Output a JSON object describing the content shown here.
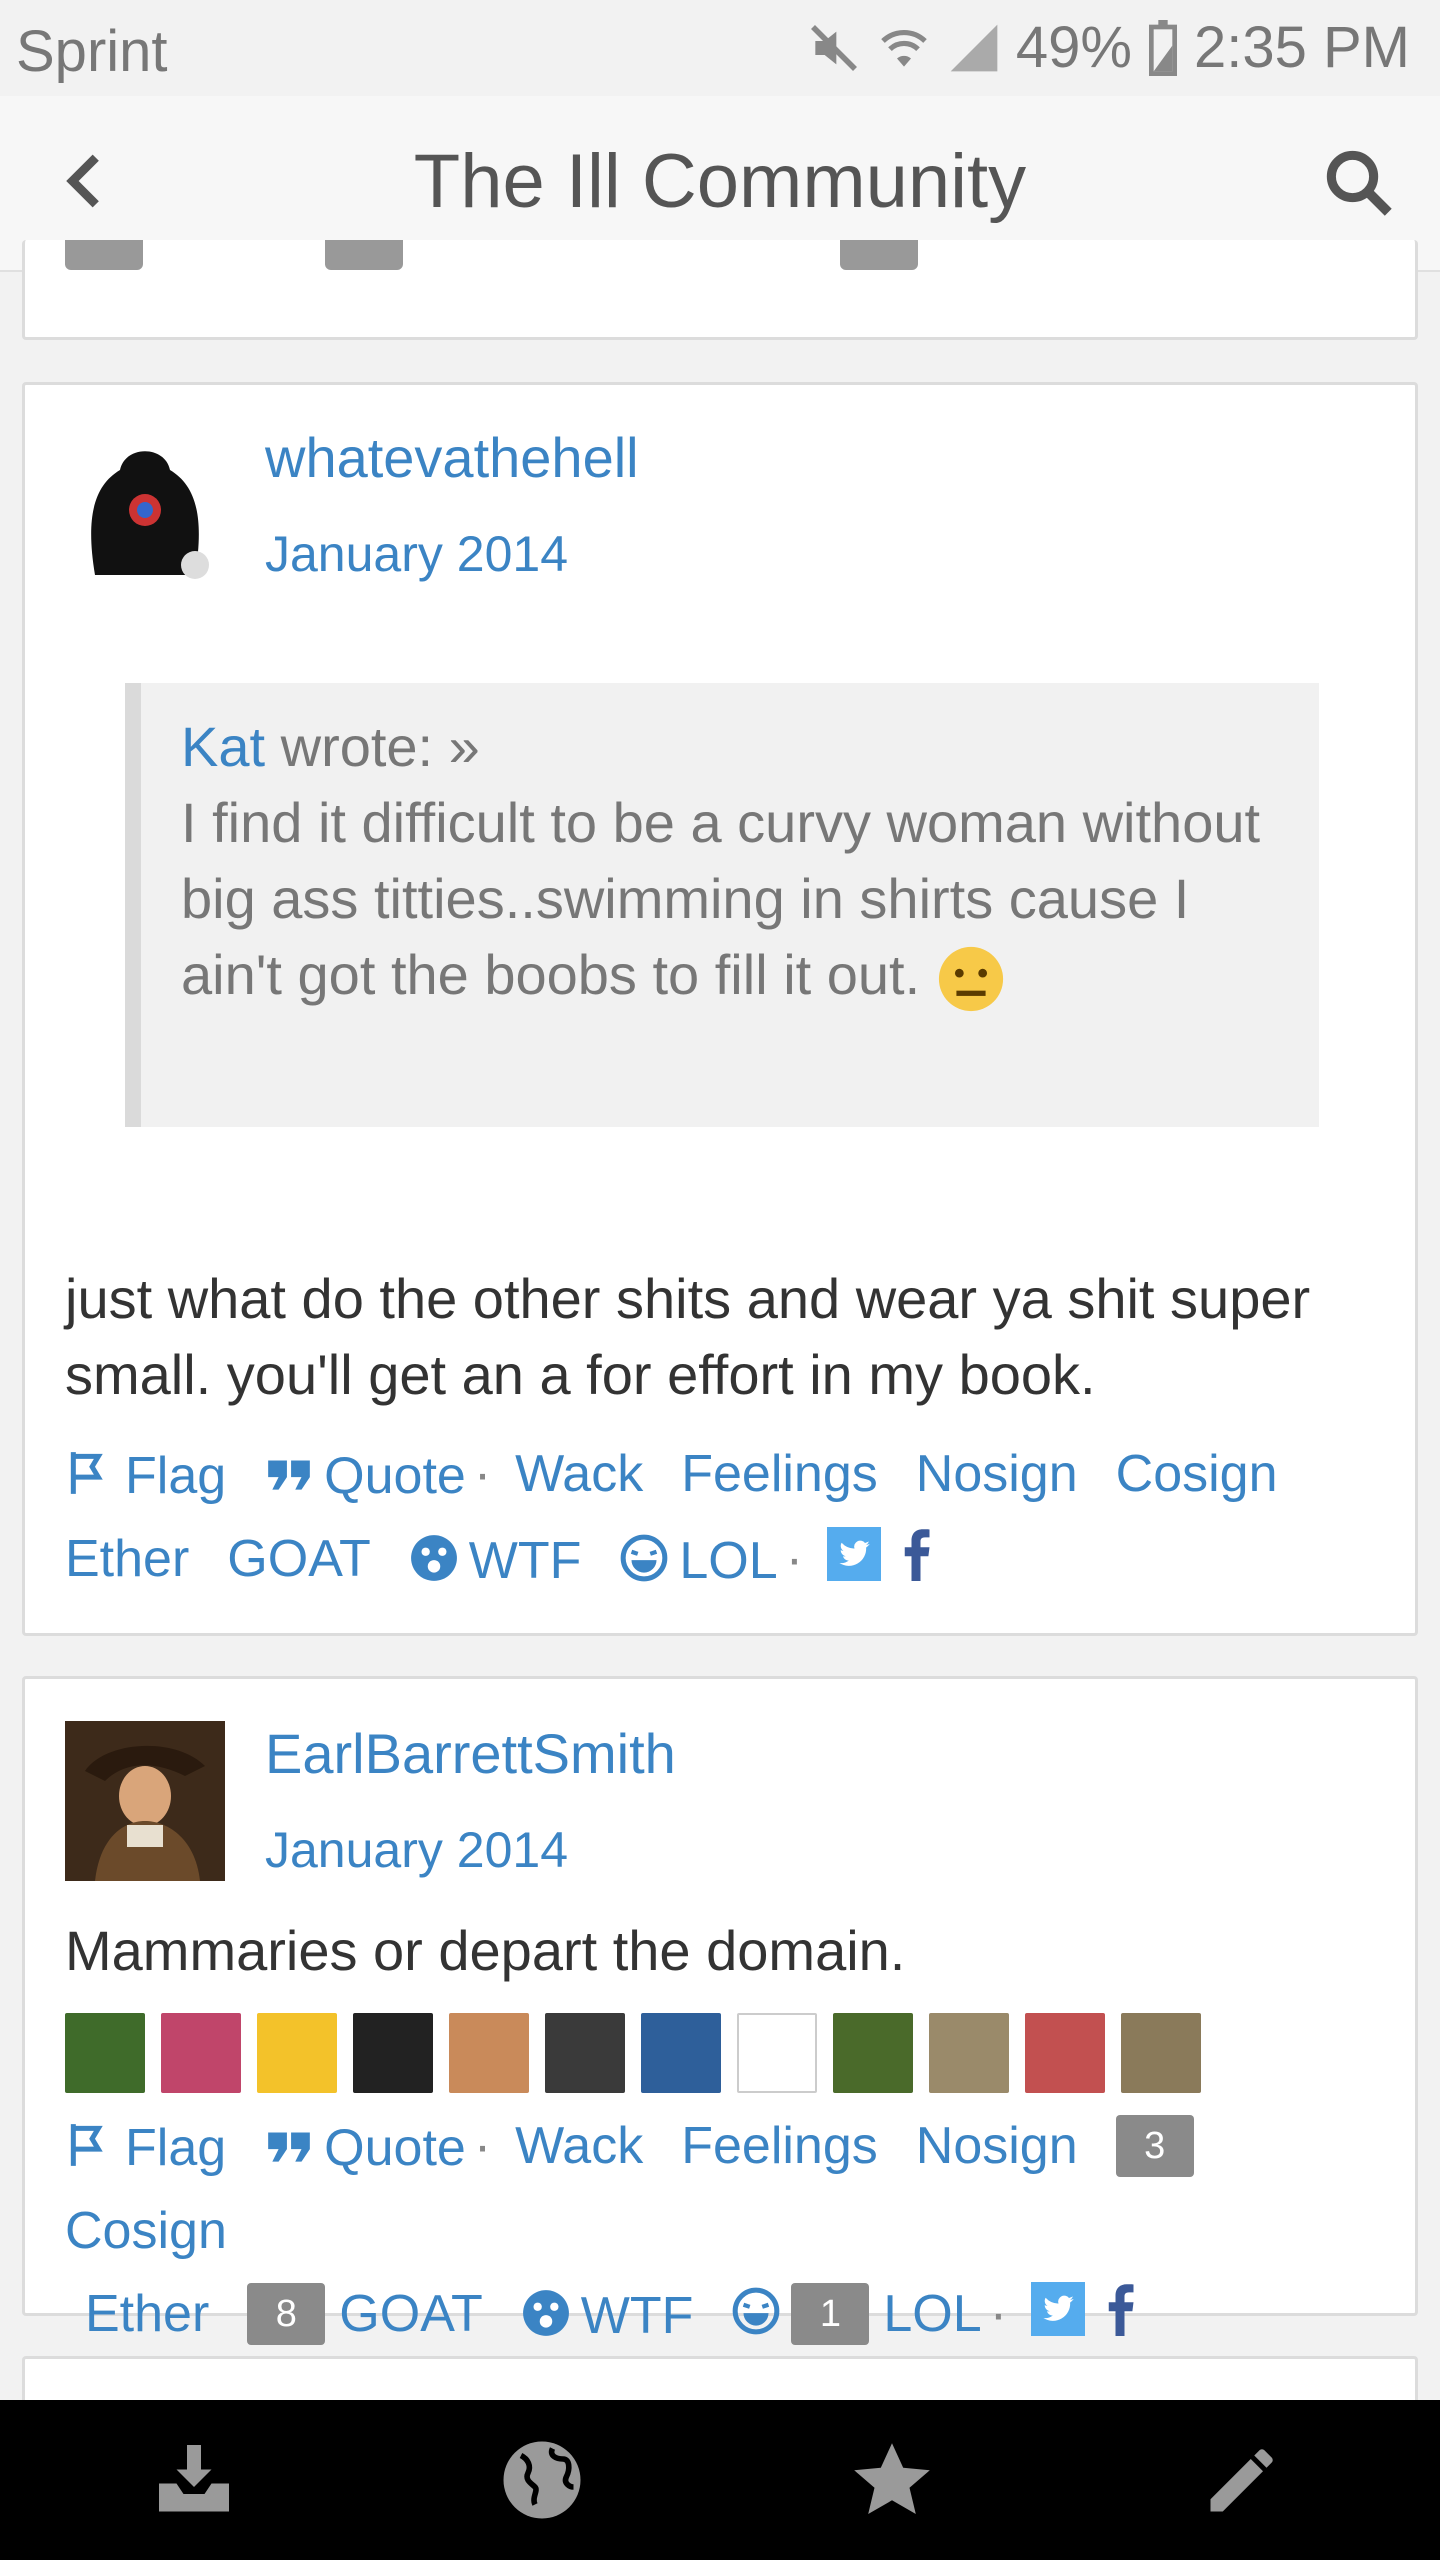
{
  "status_bar": {
    "carrier": "Sprint",
    "battery": "49%",
    "time": "2:35 PM"
  },
  "app_bar": {
    "title": "The Ill Community"
  },
  "posts": [
    {
      "username": "whatevathehell",
      "date": "January 2014",
      "quote": {
        "author": "Kat",
        "wrote": " wrote: »",
        "text": "I find it difficult to be a curvy woman without big ass titties..swimming in shirts cause I ain't got the boobs to fill it out."
      },
      "body": "just what do the other shits and wear ya shit super small. you'll get an a for effort in my book.",
      "actions": {
        "flag": "Flag",
        "quote": "Quote",
        "wack": "Wack",
        "feelings": "Feelings",
        "nosign": "Nosign",
        "cosign": "Cosign",
        "ether": "Ether",
        "goat": "GOAT",
        "wtf": "WTF",
        "lol": "LOL"
      }
    },
    {
      "username": "EarlBarrettSmith",
      "date": "January 2014",
      "body": "Mammaries or depart the domain.",
      "actions": {
        "flag": "Flag",
        "quote": "Quote",
        "wack": "Wack",
        "feelings": "Feelings",
        "nosign": "Nosign",
        "cosign_count": "3",
        "cosign": "Cosign",
        "ether": "Ether",
        "goat_count": "8",
        "goat": "GOAT",
        "wtf": "WTF",
        "lol_count": "1",
        "lol": "LOL"
      },
      "badge_colors": [
        "#3f6b2a",
        "#c0456a",
        "#f3c22a",
        "#222222",
        "#c98a5a",
        "#3a3a3a",
        "#2e5f9a",
        "#ffffff",
        "#4a6a2a",
        "#9a8a6a",
        "#c25050",
        "#8a7a5a"
      ]
    }
  ],
  "colors": {
    "link": "#3b84c4",
    "nav_bg": "#000000",
    "nav_icon": "#9a9a9a"
  },
  "icons": [
    "back-arrow-icon",
    "search-icon",
    "flag-icon",
    "quote-icon",
    "wtf-icon",
    "lol-icon",
    "twitter-icon",
    "facebook-icon",
    "inbox-icon",
    "globe-icon",
    "star-icon",
    "pencil-icon"
  ]
}
